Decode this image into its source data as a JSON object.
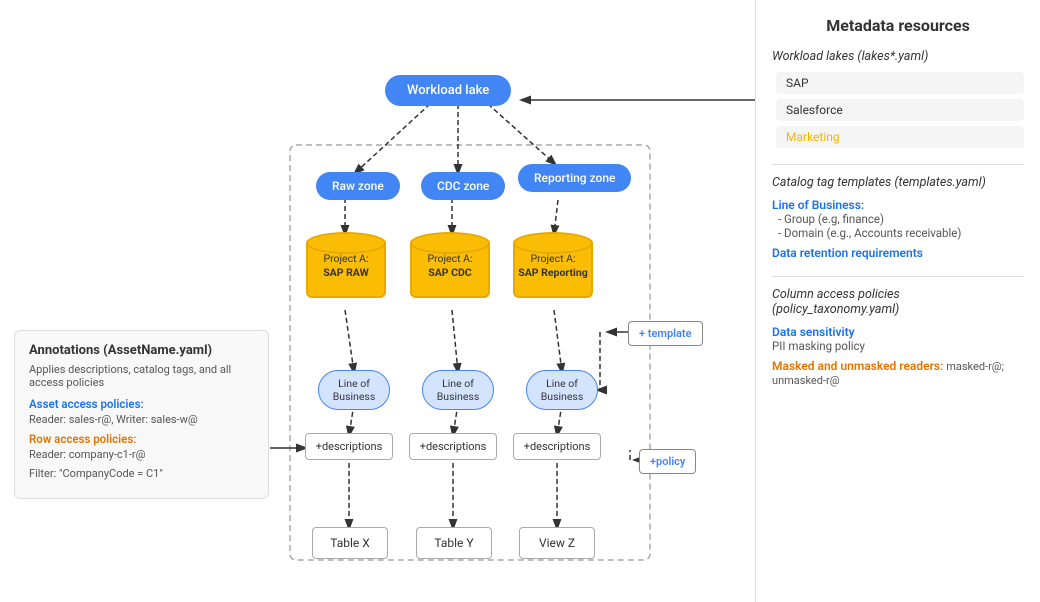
{
  "diagram": {
    "workload_lake": "Workload lake",
    "zones": {
      "raw": "Raw zone",
      "cdc": "CDC zone",
      "reporting": "Reporting zone"
    },
    "databases": {
      "raw": {
        "line1": "Project A:",
        "line2": "SAP RAW"
      },
      "cdc": {
        "line1": "Project A:",
        "line2": "SAP CDC"
      },
      "reporting": {
        "line1": "Project A:",
        "line2": "SAP Reporting"
      }
    },
    "lob": {
      "label": "Line of Business"
    },
    "descriptions": {
      "label": "+descriptions"
    },
    "tables": {
      "x": "Table X",
      "y": "Table Y",
      "z": "View Z"
    },
    "template_btn": "+ template",
    "policy_btn": "+policy"
  },
  "annotations": {
    "title": "Annotations (AssetName.yaml)",
    "description": "Applies descriptions, catalog tags, and all access policies",
    "asset_access_label": "Asset access policies:",
    "asset_access_text": "Reader: sales-r@, Writer: sales-w@",
    "row_access_label": "Row access policies:",
    "row_access_text": "Reader: company-c1-r@",
    "filter_label": "Filter:",
    "filter_text": "\"CompanyCode = C1\""
  },
  "right_panel": {
    "title": "Metadata resources",
    "workload_lakes": {
      "heading": "Workload lakes (lakes*.yaml)",
      "items": [
        "SAP",
        "Salesforce",
        "Marketing"
      ]
    },
    "catalog_tags": {
      "heading": "Catalog tag templates",
      "subheading": "(templates.yaml)",
      "lob_label": "Line of Business:",
      "items": [
        "Group (e.g, finance)",
        "Domain (e.g., Accounts receivable)"
      ],
      "retention_label": "Data retention requirements"
    },
    "column_access": {
      "heading": "Column access policies",
      "subheading": "(policy_taxonomy.yaml)",
      "sensitivity_label": "Data sensitivity",
      "pii_label": "PII masking policy",
      "masked_label": "Masked and unmasked readers:",
      "masked_text": "masked-r@; unmasked-r@"
    }
  }
}
